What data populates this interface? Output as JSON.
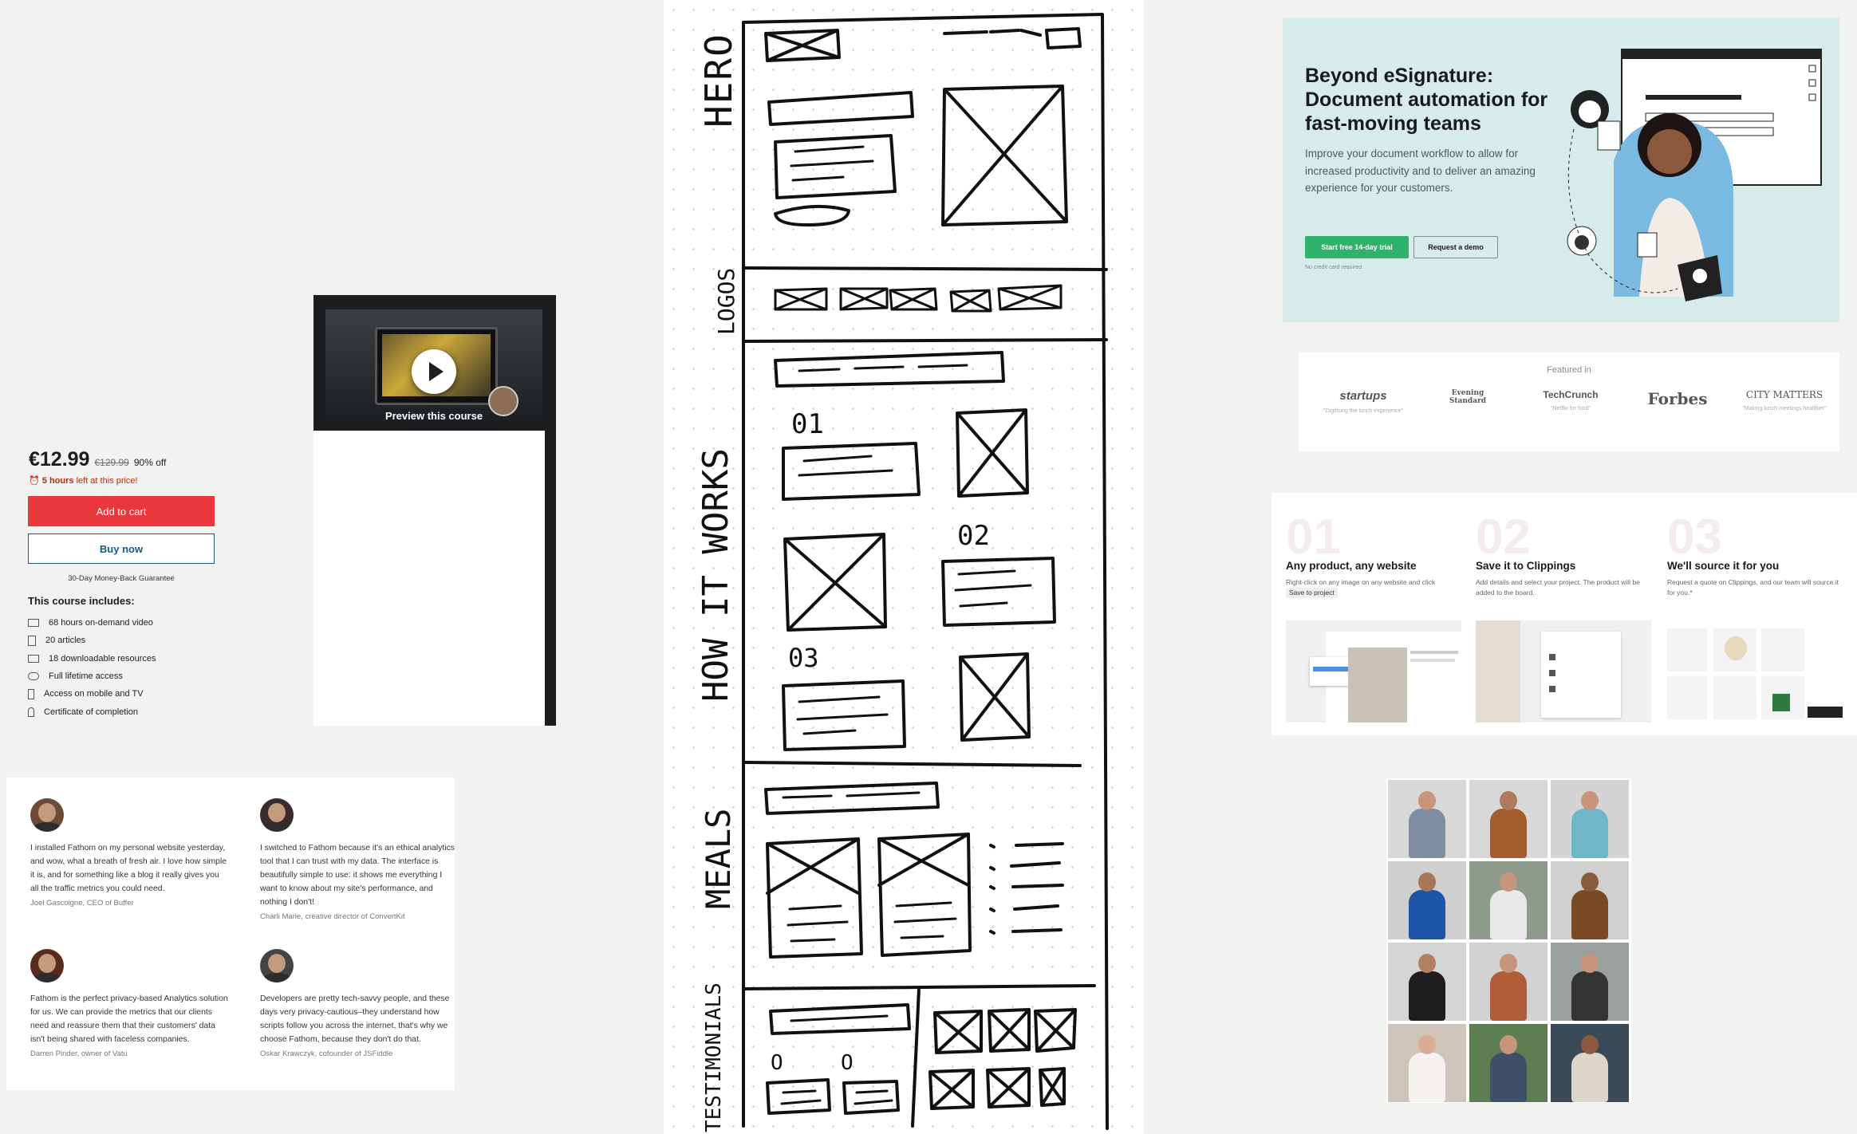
{
  "course": {
    "preview_label": "Preview this course",
    "price": "€12.99",
    "original_price": "€129.99",
    "discount": "90% off",
    "timer_hours": "5 hours",
    "timer_rest": "left at this price!",
    "add_to_cart": "Add to cart",
    "buy_now": "Buy now",
    "guarantee": "30-Day Money-Back Guarantee",
    "includes_title": "This course includes:",
    "includes": [
      "68 hours on-demand video",
      "20 articles",
      "18 downloadable resources",
      "Full lifetime access",
      "Access on mobile and TV",
      "Certificate of completion"
    ]
  },
  "testimonials": [
    {
      "quote": "I installed Fathom on my personal website yesterday, and wow, what a breath of fresh air. I love how simple it is, and for something like a blog it really gives you all the traffic metrics you could need.",
      "author": "Joel Gascoigne, CEO of Buffer"
    },
    {
      "quote": "I switched to Fathom because it's an ethical analytics tool that I can trust with my data. The interface is beautifully simple to use: it shows me everything I want to know about my site's performance, and nothing I don't!",
      "author": "Charli Marie, creative director of ConvertKit"
    },
    {
      "quote": "Fathom is the perfect privacy-based Analytics solution for us. We can provide the metrics that our clients need and reassure them that their customers' data isn't being shared with faceless companies.",
      "author": "Darren Pinder, owner of Vatu"
    },
    {
      "quote": "Developers are pretty tech-savvy people, and these days very privacy-cautious–they understand how scripts follow you across the internet, that's why we choose Fathom, because they don't do that.",
      "author": "Oskar Krawczyk, cofounder of JSFiddle"
    }
  ],
  "sketch": {
    "labels": [
      "HERO",
      "LOGOS",
      "HOW IT WORKS",
      "MEALS",
      "TESTIMONIALS"
    ],
    "step_numbers": [
      "01",
      "02",
      "03"
    ],
    "testimonial_markers": [
      "O",
      "O"
    ]
  },
  "hero": {
    "title": "Beyond eSignature: Document automation for fast-moving teams",
    "description": "Improve your document workflow to allow for increased productivity and to deliver an amazing experience for your customers.",
    "cta_primary": "Start free 14-day trial",
    "cta_secondary": "Request a demo",
    "note": "No credit card required"
  },
  "featured": {
    "label": "Featured in",
    "logos": [
      {
        "name": "startups",
        "sub": "\"Digitising the lunch experience\""
      },
      {
        "name": "Evening Standard",
        "sub": ""
      },
      {
        "name": "TechCrunch",
        "sub": "\"Netflix for food\""
      },
      {
        "name": "Forbes",
        "sub": ""
      },
      {
        "name": "CITY MATTERS",
        "sub": "\"Making lunch meetings healthier\""
      }
    ]
  },
  "steps": [
    {
      "num": "01",
      "title": "Any product, any website",
      "desc": "Right-click on any image on any website and click",
      "pill": "Save to project"
    },
    {
      "num": "02",
      "title": "Save it to Clippings",
      "desc": "Add details and select your project. The product will be added to the board.",
      "pill": ""
    },
    {
      "num": "03",
      "title": "We'll source it for you",
      "desc": "Request a quote on Clippings, and our team will source it for you.*",
      "pill": ""
    }
  ],
  "colors": {
    "udemy_red": "#e8383b",
    "hero_bg": "#d7ecea",
    "hero_green": "#2fb26a",
    "sketch_ink": "#111111"
  }
}
